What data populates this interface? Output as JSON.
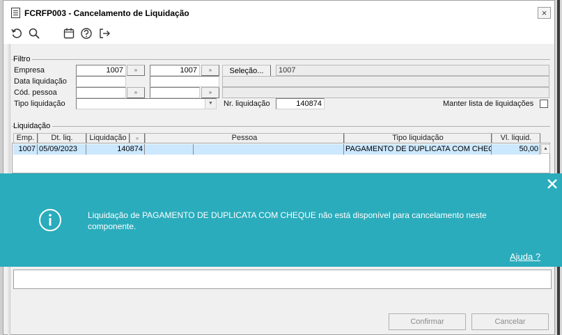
{
  "window": {
    "title": "FCRFP003 - Cancelamento de Liquidação",
    "close_glyph": "×"
  },
  "toolbar": {
    "icons": [
      "refresh-icon",
      "search-icon",
      "calendar-icon",
      "help-icon",
      "exit-icon"
    ]
  },
  "filtro": {
    "group_label": "Filtro",
    "empresa_label": "Empresa",
    "empresa_value_1": "1007",
    "empresa_value_2": "1007",
    "selecao_label": "Seleção...",
    "selecao_value": "1007",
    "data_label": "Data liquidação",
    "data_value_1": "",
    "data_value_2": "",
    "data_desc": "",
    "pessoa_label": "Cód. pessoa",
    "pessoa_value_1": "",
    "pessoa_value_2": "",
    "pessoa_desc": "",
    "tipo_label": "Tipo liquidação",
    "tipo_value": "",
    "nr_label": "Nr. liquidação",
    "nr_value": "140874",
    "manter_label": "Manter lista de liquidações",
    "manter_checked": false,
    "range_glyph": "»",
    "dropdown_glyph": "▼"
  },
  "liquidacao": {
    "group_label": "Liquidação",
    "columns": [
      "Emp.",
      "Dt. liq.",
      "Liquidação",
      "»",
      "Pessoa",
      "Tipo liquidação",
      "Vl. liquid."
    ],
    "rows": [
      {
        "emp": "1007",
        "dt": "05/09/2023",
        "liquidacao": "140874",
        "flag": "",
        "pessoa": "",
        "tipo": "PAGAMENTO DE DUPLICATA COM CHEQUE",
        "valor": "50,00"
      }
    ],
    "scroll_glyph": "▲"
  },
  "notification": {
    "message": "Liquidação de PAGAMENTO DE DUPLICATA COM CHEQUE não está disponível para cancelamento neste componente.",
    "help_link": "Ajuda ?",
    "background_color": "#2aacbc"
  },
  "footer": {
    "confirm_label": "Confirmar",
    "cancel_label": "Cancelar"
  }
}
